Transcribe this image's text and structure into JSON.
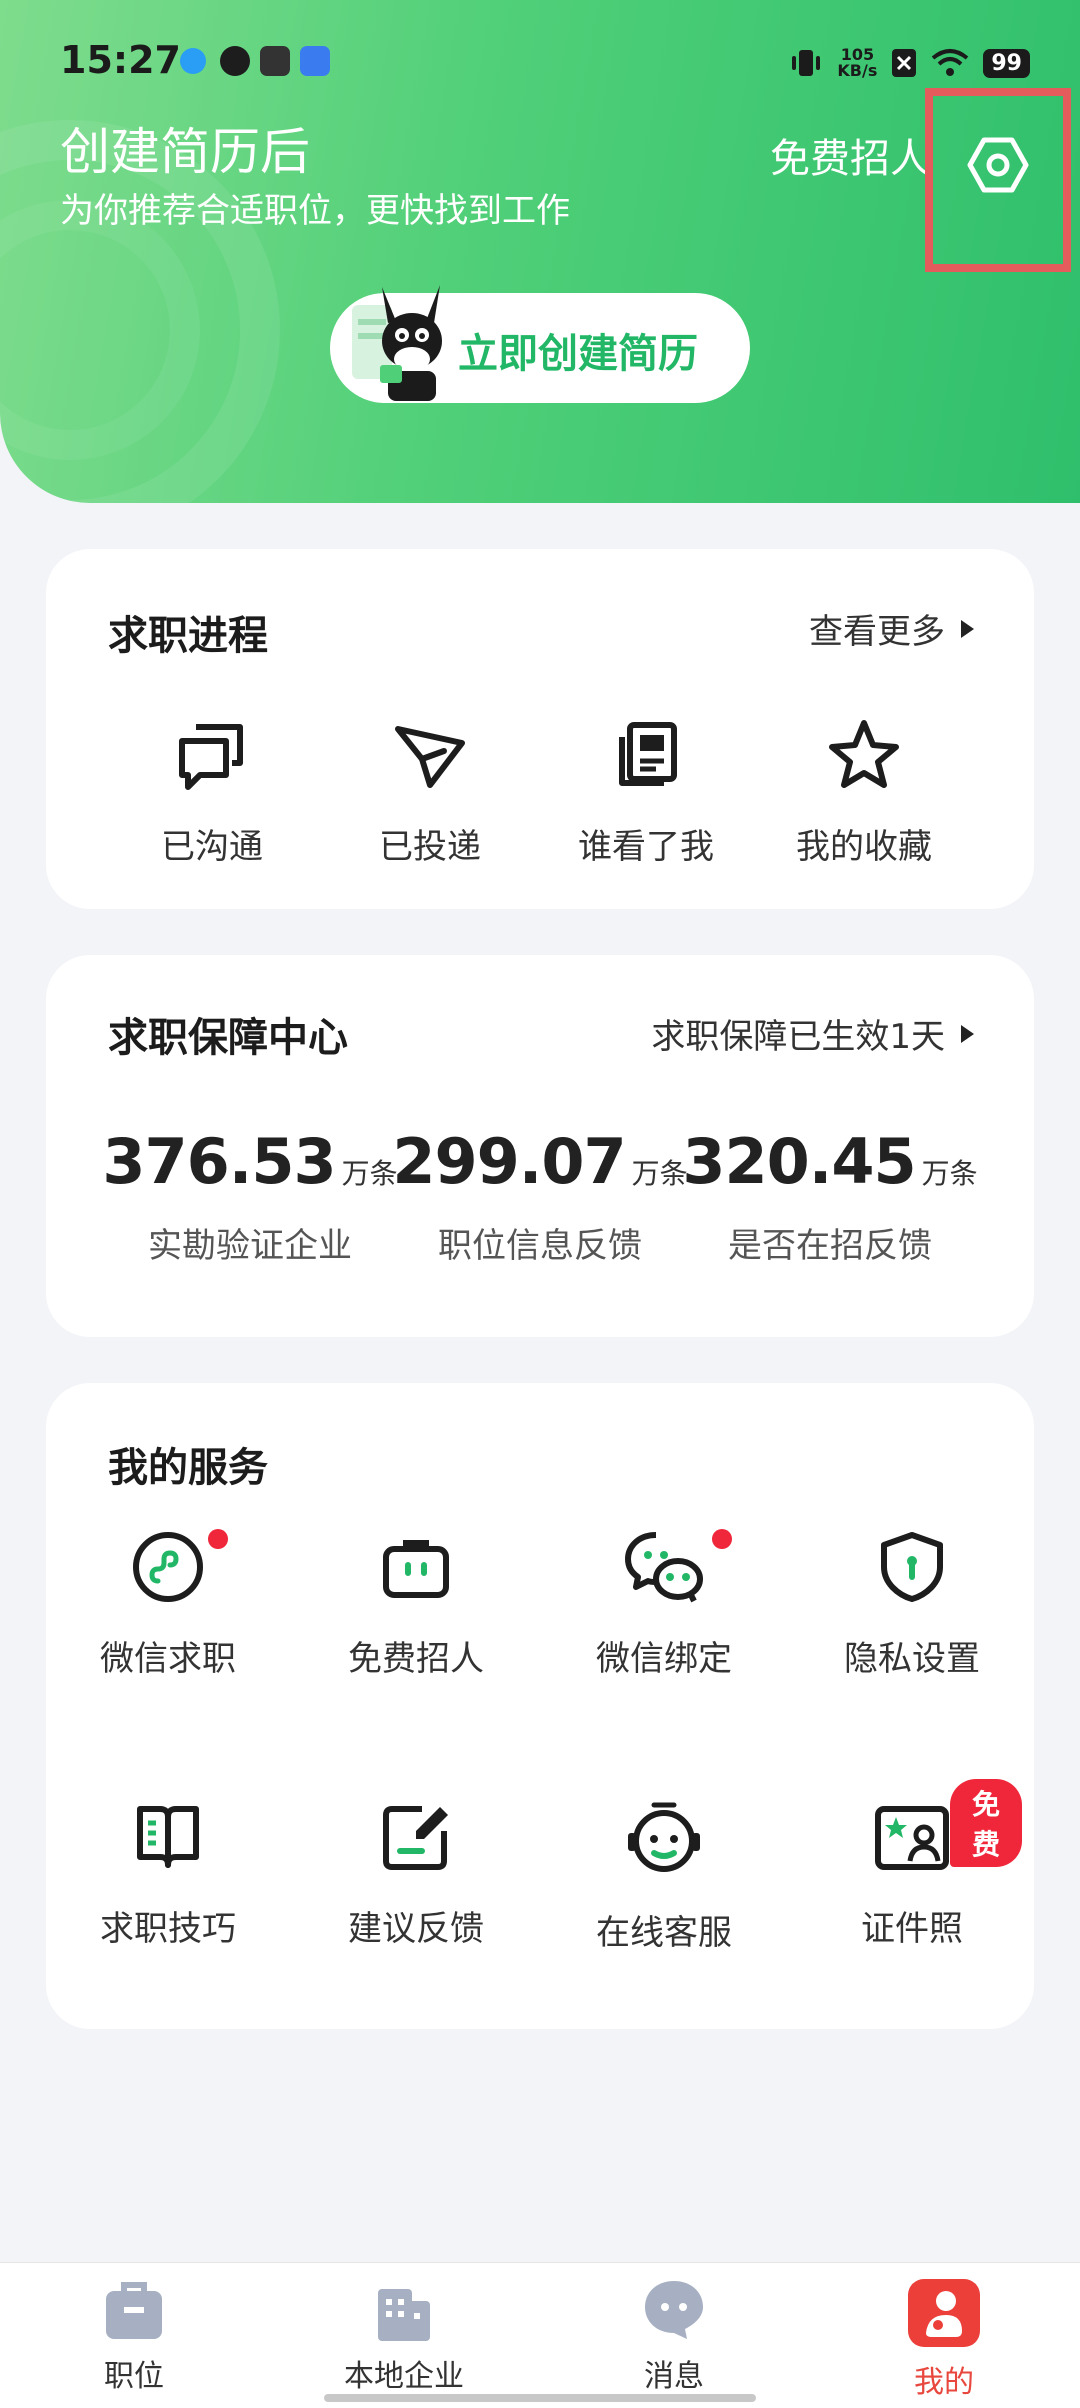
{
  "status_bar": {
    "time": "15:27",
    "net_speed_value": "105",
    "net_speed_unit": "KB/s",
    "battery": "99"
  },
  "header": {
    "title": "创建简历后",
    "subtitle": "为你推荐合适职位，更快找到工作",
    "recruit_label": "免费招人",
    "create_button_label": "立即创建简历"
  },
  "progress": {
    "title": "求职进程",
    "more_label": "查看更多",
    "items": [
      {
        "label": "已沟通",
        "icon": "chat-bubbles-icon"
      },
      {
        "label": "已投递",
        "icon": "paper-plane-icon"
      },
      {
        "label": "谁看了我",
        "icon": "document-icon"
      },
      {
        "label": "我的收藏",
        "icon": "star-icon"
      }
    ]
  },
  "guarantee": {
    "title": "求职保障中心",
    "status_label": "求职保障已生效1天",
    "stats": [
      {
        "value": "376.53",
        "unit": "万条",
        "label": "实勘验证企业"
      },
      {
        "value": "299.07",
        "unit": "万条",
        "label": "职位信息反馈"
      },
      {
        "value": "320.45",
        "unit": "万条",
        "label": "是否在招反馈"
      }
    ]
  },
  "services": {
    "title": "我的服务",
    "items": [
      {
        "label": "微信求职",
        "icon": "mini-program-icon",
        "badge_dot": true
      },
      {
        "label": "免费招人",
        "icon": "briefcase-face-icon",
        "badge_dot": false
      },
      {
        "label": "微信绑定",
        "icon": "wechat-icon",
        "badge_dot": true
      },
      {
        "label": "隐私设置",
        "icon": "shield-icon",
        "badge_dot": false
      },
      {
        "label": "求职技巧",
        "icon": "book-icon",
        "badge_dot": false
      },
      {
        "label": "建议反馈",
        "icon": "edit-icon",
        "badge_dot": false
      },
      {
        "label": "在线客服",
        "icon": "headset-icon",
        "badge_dot": false
      },
      {
        "label": "证件照",
        "icon": "id-photo-icon",
        "badge_dot": false,
        "badge_text": "免费"
      }
    ]
  },
  "bottom_nav": {
    "items": [
      {
        "label": "职位",
        "icon": "briefcase-icon",
        "active": false
      },
      {
        "label": "本地企业",
        "icon": "building-icon",
        "active": false
      },
      {
        "label": "消息",
        "icon": "message-icon",
        "active": false
      },
      {
        "label": "我的",
        "icon": "profile-icon",
        "active": true
      }
    ]
  },
  "colors": {
    "brand_green": "#22b766",
    "accent_red": "#e8473e",
    "badge_red": "#f0273a"
  }
}
